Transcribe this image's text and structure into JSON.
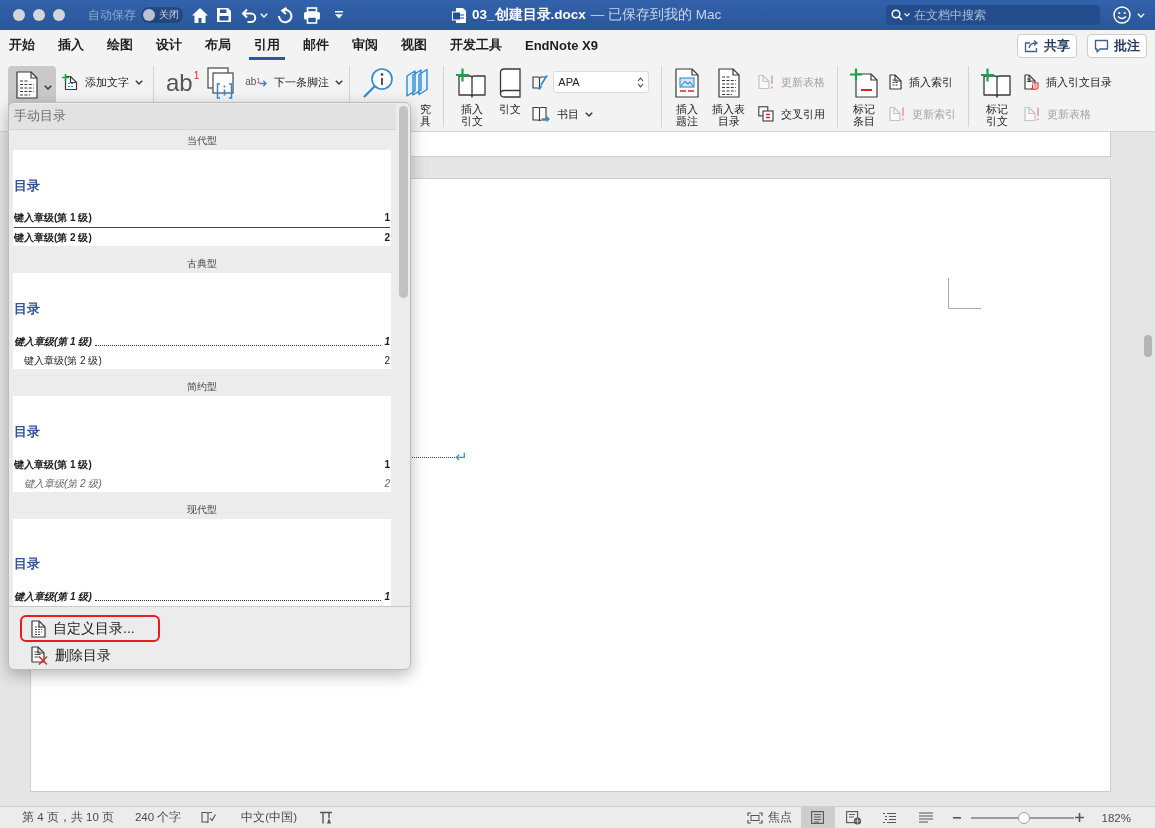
{
  "window": {
    "autosave_label": "自动保存",
    "autosave_toggle": {
      "label": "关闭",
      "on": false
    },
    "title": "03_创建目录.docx",
    "subtitle": "— 已保存到我的 Mac",
    "search": {
      "placeholder": "在文档中搜索"
    }
  },
  "ribbon_tabs": [
    {
      "label": "开始",
      "selected": false
    },
    {
      "label": "插入",
      "selected": false
    },
    {
      "label": "绘图",
      "selected": false
    },
    {
      "label": "设计",
      "selected": false
    },
    {
      "label": "布局",
      "selected": false
    },
    {
      "label": "引用",
      "selected": true
    },
    {
      "label": "邮件",
      "selected": false
    },
    {
      "label": "审阅",
      "selected": false
    },
    {
      "label": "视图",
      "selected": false
    },
    {
      "label": "开发工具",
      "selected": false
    },
    {
      "label": "EndNote X9",
      "selected": false
    }
  ],
  "ribbon_actions": [
    {
      "label": "共享"
    },
    {
      "label": "批注"
    }
  ],
  "toolbar": {
    "groups": [
      {
        "items": [
          {
            "kind": "split",
            "pressed": true,
            "dropdown": true,
            "disabled": false
          },
          {
            "kind": "small",
            "label": "添加文字",
            "pressed": false,
            "dropdown": true,
            "disabled": false
          }
        ]
      },
      {
        "items": [
          {
            "kind": "large",
            "glyph": "ab",
            "glyph_mark": "1",
            "pressed": false,
            "dropdown": false,
            "disabled": false
          },
          {
            "kind": "large",
            "pressed": false,
            "dropdown": false,
            "disabled": false
          },
          {
            "kind": "small",
            "glyph": "ab",
            "glyph_mark": "1",
            "label": "下一条脚注",
            "pressed": false,
            "dropdown": true,
            "disabled": false
          }
        ]
      },
      {
        "items": [
          {
            "kind": "large",
            "pressed": false,
            "dropdown": false,
            "disabled": false
          },
          {
            "kind": "large",
            "label_lines": [
              "究",
              "具"
            ],
            "pressed": false,
            "dropdown": false,
            "disabled": false
          }
        ]
      },
      {
        "items": [
          {
            "kind": "large",
            "label": "插入引文",
            "pressed": false,
            "dropdown": false,
            "disabled": false
          },
          {
            "kind": "large",
            "label": "引文",
            "pressed": false,
            "dropdown": false,
            "disabled": false
          },
          {
            "kind": "combo",
            "value": "APA",
            "pressed": false,
            "dropdown": false,
            "disabled": false
          },
          {
            "kind": "small",
            "label": "书目",
            "pressed": false,
            "dropdown": true,
            "disabled": false
          }
        ]
      },
      {
        "items": [
          {
            "kind": "large",
            "label": "插入题注",
            "pressed": false,
            "dropdown": false,
            "disabled": false
          },
          {
            "kind": "large",
            "label": "插入表目录",
            "pressed": false,
            "dropdown": false,
            "disabled": false
          },
          {
            "kind": "small",
            "label": "更新表格",
            "pressed": false,
            "dropdown": false,
            "disabled": true
          },
          {
            "kind": "small",
            "label": "交叉引用",
            "pressed": false,
            "dropdown": false,
            "disabled": false
          }
        ]
      },
      {
        "items": [
          {
            "kind": "large",
            "label": "标记条目",
            "pressed": false,
            "dropdown": false,
            "disabled": false
          },
          {
            "kind": "small",
            "label": "插入索引",
            "pressed": false,
            "dropdown": false,
            "disabled": false
          },
          {
            "kind": "small",
            "label": "更新索引",
            "pressed": false,
            "dropdown": false,
            "disabled": true
          }
        ]
      },
      {
        "items": [
          {
            "kind": "large",
            "label": "标记引文",
            "pressed": false,
            "dropdown": false,
            "disabled": false
          },
          {
            "kind": "small",
            "label": "插入引文目录",
            "pressed": false,
            "dropdown": false,
            "disabled": false
          },
          {
            "kind": "small",
            "label": "更新表格",
            "pressed": false,
            "dropdown": false,
            "disabled": true
          }
        ]
      }
    ]
  },
  "document": {
    "paragraph_mark": "↵"
  },
  "toc_menu": {
    "header": "手动目录",
    "styles": [
      {
        "name": "当代型",
        "kind": "contemporary",
        "title": "目录",
        "entries": [
          {
            "text": "键入章级(第 1 级)",
            "page": "1",
            "children": [
              {
                "text": "键入章级(第 2 级)",
                "page": "2"
              }
            ]
          }
        ]
      },
      {
        "name": "古典型",
        "kind": "classic",
        "title": "目录",
        "entries": [
          {
            "text": "键入章级(第 1 级)",
            "page": "1",
            "children": [
              {
                "text": "键入章级(第 2 级)",
                "page": "2"
              }
            ]
          }
        ]
      },
      {
        "name": "简约型",
        "kind": "simple",
        "title": "目录",
        "entries": [
          {
            "text": "键入章级(第 1 级)",
            "page": "1",
            "children": [
              {
                "text": "键入章级(第 2 级)",
                "page": "2"
              }
            ]
          }
        ]
      },
      {
        "name": "现代型",
        "kind": "modern",
        "title": "目录",
        "entries": [
          {
            "text": "键入章级(第 1 级)",
            "page": "1"
          }
        ]
      }
    ],
    "actions": [
      {
        "label": "自定义目录...",
        "highlighted": true
      },
      {
        "label": "删除目录",
        "highlighted": false
      }
    ]
  },
  "status_bar": {
    "page": "第 4 页，共 10 页",
    "words": "240 个字",
    "language": "中文(中国)",
    "focus": "焦点",
    "views": [
      {
        "selected": true
      },
      {
        "selected": false
      },
      {
        "selected": false
      },
      {
        "selected": false
      }
    ],
    "zoom": {
      "level": 0.52,
      "reading": "182%"
    }
  }
}
